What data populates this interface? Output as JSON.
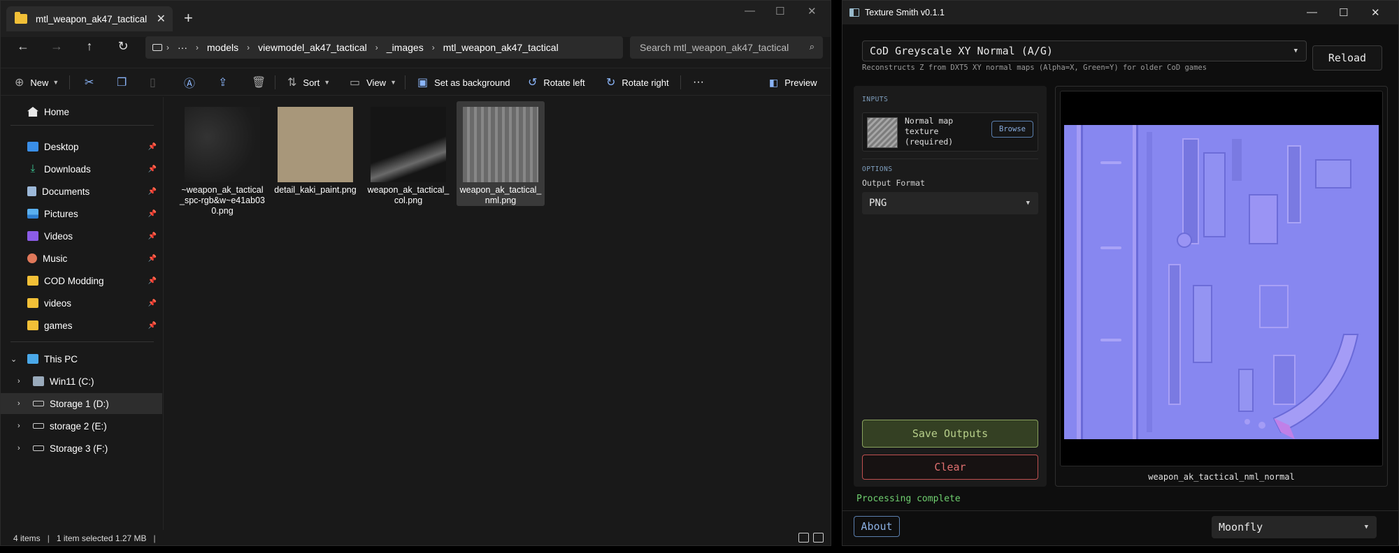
{
  "explorer": {
    "tab_title": "mtl_weapon_ak47_tactical",
    "breadcrumb": [
      "models",
      "viewmodel_ak47_tactical",
      "_images",
      "mtl_weapon_ak47_tactical"
    ],
    "breadcrumb_more": "···",
    "search_placeholder": "Search mtl_weapon_ak47_tactical",
    "toolbar": {
      "new": "New",
      "sort": "Sort",
      "view": "View",
      "set_background": "Set as background",
      "rotate_left": "Rotate left",
      "rotate_right": "Rotate right",
      "more": "···",
      "preview": "Preview"
    },
    "nav": {
      "home": "Home",
      "quick": [
        "Desktop",
        "Downloads",
        "Documents",
        "Pictures",
        "Videos",
        "Music",
        "COD Modding",
        "videos",
        "games"
      ],
      "this_pc": "This PC",
      "drives": [
        "Win11 (C:)",
        "Storage 1 (D:)",
        "storage 2 (E:)",
        "Storage 3 (F:)"
      ]
    },
    "files": [
      {
        "name": "~weapon_ak_tactical_spc-rgb&w~e41ab030.png",
        "thumb_color": "#262626"
      },
      {
        "name": "detail_kaki_paint.png",
        "thumb_color": "#a8977a"
      },
      {
        "name": "weapon_ak_tactical_col.png",
        "thumb_color": "#1c1c1c"
      },
      {
        "name": "weapon_ak_tactical_nml.png",
        "thumb_color": "#7a7a7a"
      }
    ],
    "status": {
      "items": "4 items",
      "selected": "1 item selected  1.27 MB"
    }
  },
  "texture_smith": {
    "title": "Texture Smith v0.1.1",
    "mode": "CoD Greyscale XY Normal (A/G)",
    "mode_description": "Reconstructs Z from DXT5 XY normal maps (Alpha=X, Green=Y) for older CoD games",
    "reload": "Reload",
    "inputs_label": "INPUTS",
    "input_label": "Normal map texture (required)",
    "browse": "Browse",
    "options_label": "OPTIONS",
    "output_format_label": "Output Format",
    "output_format": "PNG",
    "save": "Save Outputs",
    "clear": "Clear",
    "preview_name": "weapon_ak_tactical_nml_normal",
    "status": "Processing complete",
    "about": "About",
    "theme": "Moonfly"
  },
  "colors": {
    "accent_blue": "#8aaee0",
    "save_green": "#b7cf8a",
    "clear_red": "#e07070",
    "status_green": "#6fcf6f",
    "normal_map": "#8787f0"
  }
}
